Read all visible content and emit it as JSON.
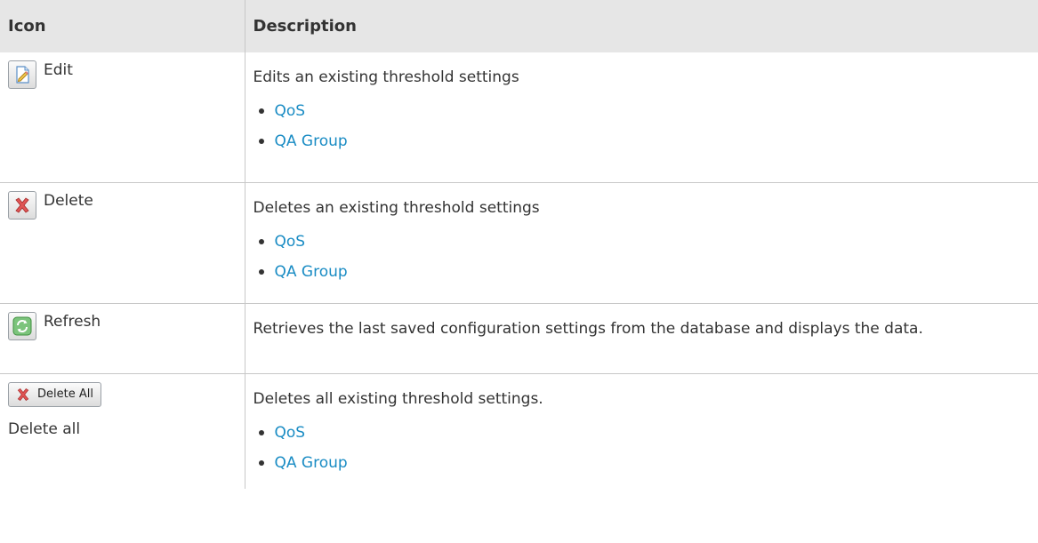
{
  "header": {
    "icon_col": "Icon",
    "description_col": "Description"
  },
  "rows": [
    {
      "icon": "edit-icon",
      "label": "Edit",
      "description": "Edits an existing threshold settings",
      "links": [
        "QoS",
        "QA Group"
      ]
    },
    {
      "icon": "delete-icon",
      "label": "Delete",
      "description": "Deletes an existing threshold settings",
      "links": [
        "QoS",
        "QA Group"
      ]
    },
    {
      "icon": "refresh-icon",
      "label": "Refresh",
      "description": "Retrieves the last saved configuration settings from the database and displays the data.",
      "links": []
    },
    {
      "icon": "delete-all-icon",
      "button_text": "Delete All",
      "label": "Delete all",
      "description": "Deletes all existing threshold settings.",
      "links": [
        "QoS",
        "QA Group"
      ]
    }
  ],
  "colors": {
    "link": "#1a8cc4",
    "header_bg": "#e6e6e6",
    "border": "#c8c8c8",
    "text": "#333333"
  }
}
